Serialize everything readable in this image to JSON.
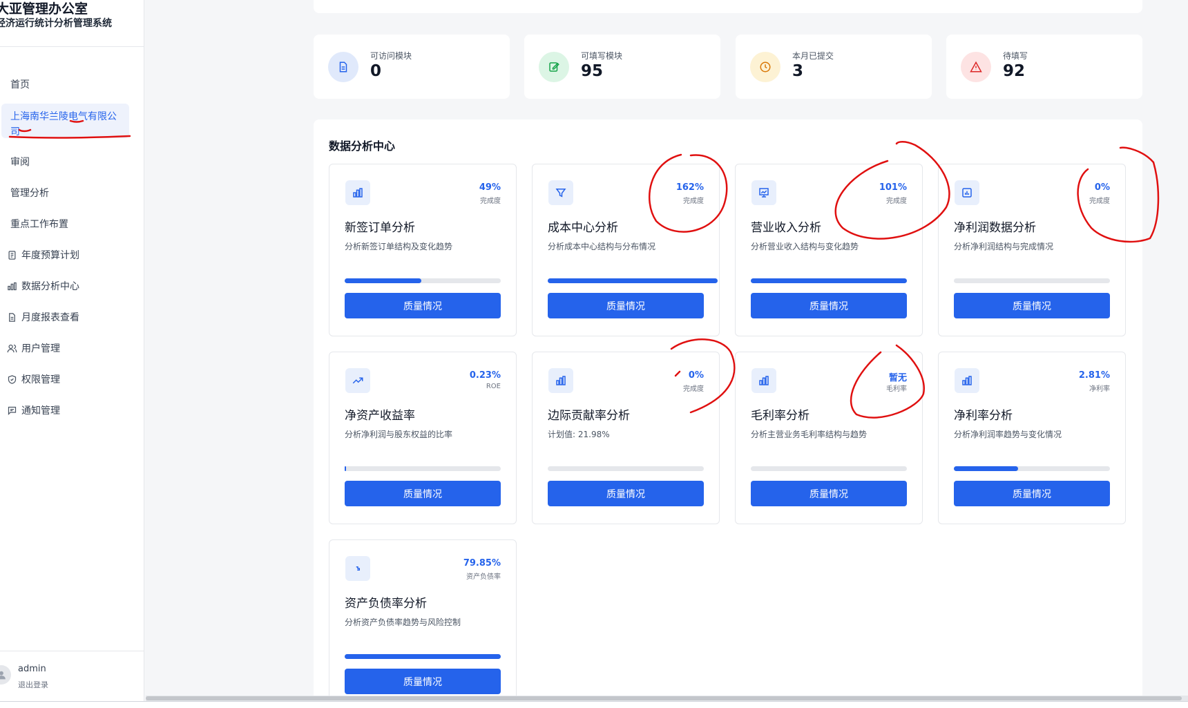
{
  "sidebar": {
    "brand_title": "大亚管理办公室",
    "brand_subtitle": "经济运行统计分析管理系统",
    "items": [
      {
        "label": "首页",
        "icon": ""
      },
      {
        "label": "上海南华兰陵电气有限公司",
        "icon": "",
        "active": true
      },
      {
        "label": "审阅",
        "icon": ""
      },
      {
        "label": "管理分析",
        "icon": ""
      },
      {
        "label": "重点工作布置",
        "icon": ""
      },
      {
        "label": "年度预算计划",
        "icon": "clipboard-icon"
      },
      {
        "label": "数据分析中心",
        "icon": "bar-chart-icon"
      },
      {
        "label": "月度报表查看",
        "icon": "document-icon"
      },
      {
        "label": "用户管理",
        "icon": "users-icon"
      },
      {
        "label": "权限管理",
        "icon": "shield-icon"
      },
      {
        "label": "通知管理",
        "icon": "message-icon"
      }
    ],
    "user": {
      "name": "admin",
      "logout_label": "退出登录"
    }
  },
  "stats": [
    {
      "label": "可访问模块",
      "value": "0",
      "icon": "document-icon",
      "color": "#2563eb",
      "bg": "#e0e9fb"
    },
    {
      "label": "可填写模块",
      "value": "95",
      "icon": "edit-icon",
      "color": "#16a34a",
      "bg": "#dcf5e5"
    },
    {
      "label": "本月已提交",
      "value": "3",
      "icon": "clock-icon",
      "color": "#d97706",
      "bg": "#fdf2d4"
    },
    {
      "label": "待填写",
      "value": "92",
      "icon": "alert-icon",
      "color": "#dc2626",
      "bg": "#fde3e3"
    }
  ],
  "panel": {
    "title": "数据分析中心"
  },
  "cards": [
    {
      "title": "新签订单分析",
      "desc": "分析新签订单结构及变化趋势",
      "pct": "49%",
      "pct_label": "完成度",
      "progress": 0.49,
      "icon": "bar-chart-icon",
      "button": "质量情况"
    },
    {
      "title": "成本中心分析",
      "desc": "分析成本中心结构与分布情况",
      "pct": "162%",
      "pct_label": "完成度",
      "progress": 1.62,
      "icon": "filter-icon",
      "button": "质量情况"
    },
    {
      "title": "营业收入分析",
      "desc": "分析营业收入结构与变化趋势",
      "pct": "101%",
      "pct_label": "完成度",
      "progress": 1.0,
      "icon": "presentation-chart-icon",
      "button": "质量情况"
    },
    {
      "title": "净利润数据分析",
      "desc": "分析净利润结构与完成情况",
      "pct": "0%",
      "pct_label": "完成度",
      "progress": 0,
      "icon": "chart-square-icon",
      "button": "质量情况"
    },
    {
      "title": "净资产收益率",
      "desc": "分析净利润与股东权益的比率",
      "pct": "0.23%",
      "pct_label": "ROE",
      "progress": 0.0023,
      "icon": "trending-up-icon",
      "button": "质量情况"
    },
    {
      "title": "边际贡献率分析",
      "desc": "计划值: 21.98%",
      "pct": "0%",
      "pct_label": "完成度",
      "progress": 0,
      "icon": "bar-chart-icon",
      "button": "质量情况"
    },
    {
      "title": "毛利率分析",
      "desc": "分析主营业务毛利率结构与趋势",
      "pct": "暂无",
      "pct_label": "毛利率",
      "progress": 0,
      "icon": "bar-chart-icon",
      "button": "质量情况"
    },
    {
      "title": "净利率分析",
      "desc": "分析净利润率趋势与变化情况",
      "pct": "2.81%",
      "pct_label": "净利率",
      "progress": 0.41,
      "icon": "bar-chart-icon",
      "button": "质量情况"
    },
    {
      "title": "资产负债率分析",
      "desc": "分析资产负债率趋势与风险控制",
      "pct": "79.85%",
      "pct_label": "资产负债率",
      "progress": 1.0,
      "icon": "steps-icon",
      "button": "质量情况"
    }
  ],
  "colors": {
    "accent": "#2563eb",
    "annotation": "#e01010"
  }
}
